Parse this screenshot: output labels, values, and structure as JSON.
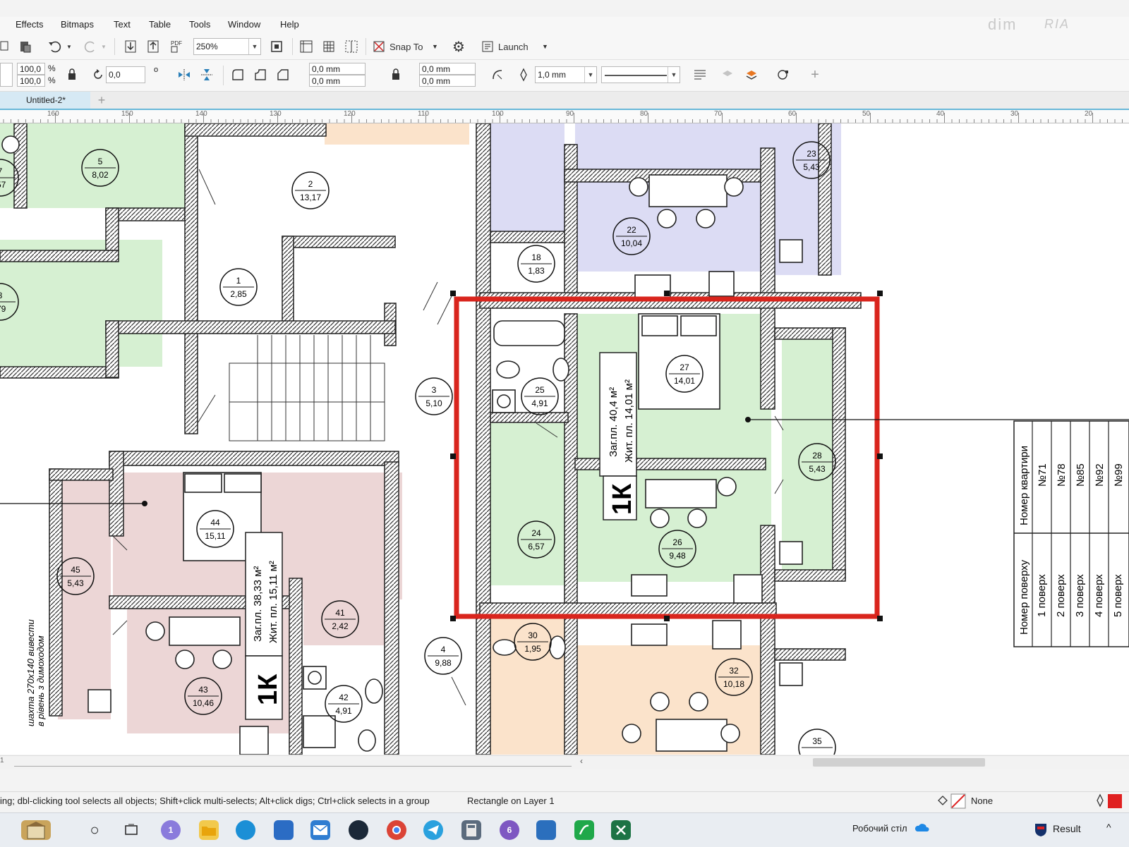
{
  "menu": {
    "effects": "Effects",
    "bitmaps": "Bitmaps",
    "text": "Text",
    "table": "Table",
    "tools": "Tools",
    "window": "Window",
    "help": "Help"
  },
  "brand_watermark": {
    "left": "dim",
    "right": "RIA"
  },
  "toolbar": {
    "zoom_value": "250%",
    "snap_label": "Snap To",
    "launch_label": "Launch"
  },
  "property_bar": {
    "scale_x": "100,0",
    "scale_y": "100,0",
    "percent": "%",
    "angle": "0,0",
    "degree": "o",
    "pos_x": "0,0 mm",
    "pos_y": "0,0 mm",
    "corner_x": "0,0 mm",
    "corner_y": "0,0 mm",
    "outline_width": "1,0 mm",
    "plus": "+"
  },
  "document_tab": {
    "title": "Untitled-2*",
    "add": "+"
  },
  "ruler_labels": [
    "160",
    "150",
    "140",
    "130",
    "120",
    "110",
    "100",
    "90",
    "80",
    "70",
    "60",
    "50",
    "40",
    "30",
    "20"
  ],
  "floorplan": {
    "rooms": [
      {
        "num": "5",
        "area": "8,02"
      },
      {
        "num": "7",
        "area": ",57"
      },
      {
        "num": "2",
        "area": "13,17"
      },
      {
        "num": "1",
        "area": "2,85"
      },
      {
        "num": "8",
        "area": ",79"
      },
      {
        "num": "3",
        "area": "5,10"
      },
      {
        "num": "18",
        "area": "1,83"
      },
      {
        "num": "22",
        "area": "10,04"
      },
      {
        "num": "23",
        "area": "5,43"
      },
      {
        "num": "25",
        "area": "4,91"
      },
      {
        "num": "27",
        "area": "14,01"
      },
      {
        "num": "28",
        "area": "5,43"
      },
      {
        "num": "24",
        "area": "6,57"
      },
      {
        "num": "26",
        "area": "9,48"
      },
      {
        "num": "44",
        "area": "15,11"
      },
      {
        "num": "45",
        "area": "5,43"
      },
      {
        "num": "41",
        "area": "2,42"
      },
      {
        "num": "4",
        "area": "9,88"
      },
      {
        "num": "43",
        "area": "10,46"
      },
      {
        "num": "42",
        "area": "4,91"
      },
      {
        "num": "30",
        "area": "1,95"
      },
      {
        "num": "32",
        "area": "10,18"
      },
      {
        "num": "35",
        "area": ""
      }
    ],
    "apartment_a": {
      "line1": "Заг.пл. 40,4 м²",
      "line2": "Жит. пл. 14,01 м²",
      "type": "1К"
    },
    "apartment_b": {
      "line1": "Заг.пл. 38,33 м²",
      "line2": "Жит. пл. 15,11 м²",
      "type": "1К"
    },
    "shaft_note": {
      "line1": "шахта 270х140 вивести",
      "line2": "в рівень з димоходом"
    },
    "table": {
      "col1_header": "Номер поверху",
      "col2_header": "Номер квартири",
      "floors": [
        "1 поверх",
        "2 поверх",
        "3 поверх",
        "4 поверх",
        "5 поверх"
      ],
      "apartments": [
        "№71",
        "№78",
        "№85",
        "№92",
        "№99"
      ]
    }
  },
  "status": {
    "hint": "ing; dbl-clicking tool selects all objects; Shift+click multi-selects; Alt+click digs; Ctrl+click selects in a group",
    "object": "Rectangle on Layer 1",
    "fill": "None",
    "page_num": "1"
  },
  "taskbar": {
    "desktop_label": "Робочий стіл",
    "result_label": "Result",
    "chevron": "^",
    "badge1": "1",
    "badge2": "6"
  },
  "colors": {
    "selection": "#d9251d",
    "green": "#d6f0d2",
    "purple": "#dcdcf4",
    "pink": "#ecd6d6",
    "peach": "#fbe3cb",
    "fill_swatch": "#e02020"
  }
}
